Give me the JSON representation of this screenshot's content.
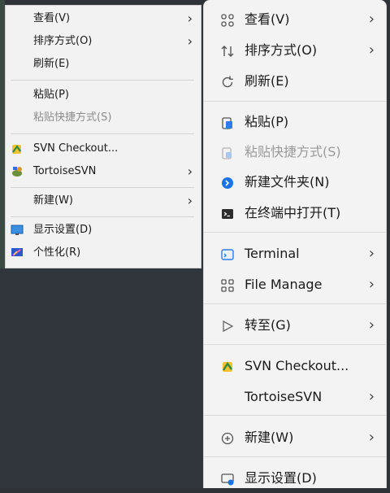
{
  "left_menu": {
    "view": "查看(V)",
    "sort": "排序方式(O)",
    "refresh": "刷新(E)",
    "paste": "粘贴(P)",
    "paste_shortcut": "粘贴快捷方式(S)",
    "svn_checkout": "SVN Checkout...",
    "tortoise": "TortoiseSVN",
    "new": "新建(W)",
    "display": "显示设置(D)",
    "personalize": "个性化(R)",
    "submenu_arrow": "›"
  },
  "right_menu": {
    "view": "查看(V)",
    "sort": "排序方式(O)",
    "refresh": "刷新(E)",
    "paste": "粘贴(P)",
    "paste_shortcut": "粘贴快捷方式(S)",
    "new_folder": "新建文件夹(N)",
    "open_terminal": "在终端中打开(T)",
    "terminal": "Terminal",
    "file_manage": "File Manage",
    "goto": "转至(G)",
    "svn_checkout": "SVN Checkout...",
    "tortoise": "TortoiseSVN",
    "new": "新建(W)",
    "display": "显示设置(D)",
    "submenu_arrow": "›"
  },
  "icons": {
    "svn_checkout": "svn-checkout-icon",
    "tortoise": "tortoisesvn-icon",
    "display": "display-settings-icon",
    "personalize": "personalize-icon",
    "view": "view-grid-icon",
    "sort": "sort-arrows-icon",
    "refresh": "refresh-icon",
    "paste": "paste-icon",
    "new_folder": "new-folder-icon",
    "terminal": "terminal-icon",
    "file_manage": "file-manage-icon",
    "goto": "goto-arrow-icon",
    "new": "new-plus-icon"
  },
  "colors": {
    "accent_blue": "#1a73e8",
    "menu_bg": "#f3f3f3",
    "disabled_text": "#9a9a9a"
  }
}
